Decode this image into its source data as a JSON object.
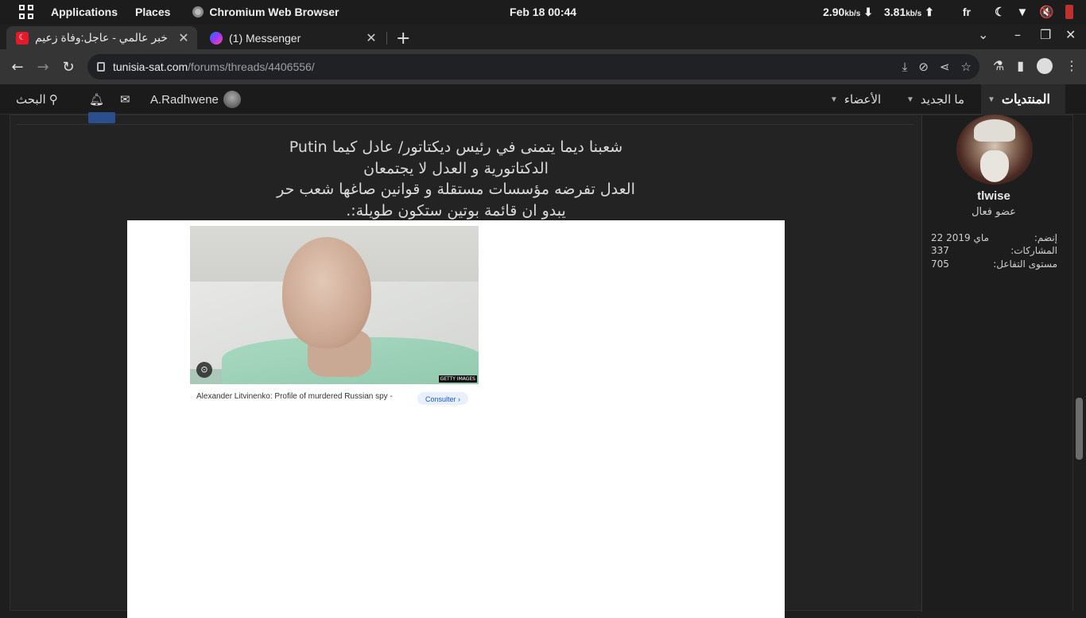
{
  "system_bar": {
    "applications": "Applications",
    "places": "Places",
    "active_app": "Chromium Web Browser",
    "clock": "Feb 18  00:44",
    "net_down_value": "2.90",
    "net_down_unit": "kb/s",
    "net_up_value": "3.81",
    "net_up_unit": "kb/s",
    "keyboard_layout": "fr"
  },
  "tabs": [
    {
      "title": "خبر عالمي - عاجل:وفاة زعيم",
      "favicon": "tunisia-sat-favicon",
      "active": true
    },
    {
      "title": "(1) Messenger",
      "favicon": "messenger-favicon",
      "active": false
    }
  ],
  "address_bar": {
    "domain": "tunisia-sat.com",
    "path": "/forums/threads/4406556/"
  },
  "forum_nav": {
    "forums": "المنتديات",
    "whats_new": "ما الجديد",
    "members": "الأعضاء",
    "username": "A.Radhwene",
    "search": "البحث"
  },
  "post": {
    "message_lines": [
      "شعبنا ديما يتمنى في رئيس ديكتاتور/ عادل كيما Putin",
      "الدكتاتورية و العدل لا يجتمعان",
      "العدل تفرضه مؤسسات مستقلة و قوانين صاغها شعب حر",
      "يبدو ان قائمة بوتين ستكون طويلة:."
    ],
    "embed": {
      "image_watermark": "GETTY IMAGES",
      "caption": "Alexander Litvinenko: Profile of murdered Russian spy -",
      "consult_button": "Consulter ›"
    }
  },
  "author": {
    "name": "tlwise",
    "title": "عضو فعال",
    "stats": [
      {
        "label": "إنضم:",
        "value": "22 ماي 2019"
      },
      {
        "label": "المشاركات:",
        "value": "337"
      },
      {
        "label": "مستوى التفاعل:",
        "value": "705"
      }
    ]
  }
}
